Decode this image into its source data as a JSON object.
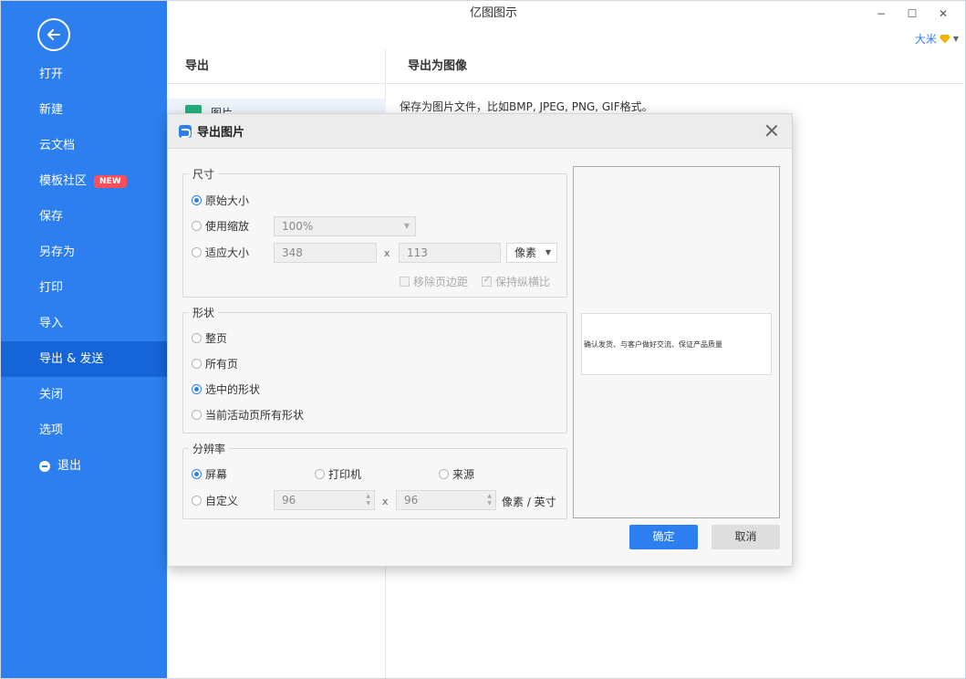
{
  "window": {
    "title": "亿图图示",
    "user_name": "大米",
    "controls": {
      "minimize": "−",
      "maximize": "☐",
      "close": "✕"
    }
  },
  "sidebar": {
    "back_icon": "arrow-left-icon",
    "items": [
      {
        "label": "打开"
      },
      {
        "label": "新建"
      },
      {
        "label": "云文档"
      },
      {
        "label": "模板社区",
        "badge": "NEW"
      },
      {
        "label": "保存"
      },
      {
        "label": "另存为"
      },
      {
        "label": "打印"
      },
      {
        "label": "导入"
      },
      {
        "label": "导出 & 发送",
        "active": true
      },
      {
        "label": "关闭"
      },
      {
        "label": "选项"
      },
      {
        "label": "退出",
        "icon": "minus-circle-icon"
      }
    ]
  },
  "left_panel": {
    "title": "导出",
    "item_label": "图片"
  },
  "right_panel": {
    "title": "导出为图像",
    "description": "保存为图片文件，比如BMP, JPEG, PNG, GIF格式。"
  },
  "dialog": {
    "title": "导出图片",
    "size": {
      "legend": "尺寸",
      "original": "原始大小",
      "use_zoom": "使用缩放",
      "zoom_value": "100%",
      "fit_size": "适应大小",
      "width": "348",
      "height": "113",
      "x": "x",
      "unit": "像素",
      "remove_margin": "移除页边距",
      "keep_ratio": "保持纵横比"
    },
    "shape": {
      "legend": "形状",
      "whole_page": "整页",
      "all_pages": "所有页",
      "selected_shapes": "选中的形状",
      "current_page_shapes": "当前活动页所有形状"
    },
    "resolution": {
      "legend": "分辨率",
      "screen": "屏幕",
      "printer": "打印机",
      "source": "来源",
      "custom": "自定义",
      "dpi_x": "96",
      "dpi_y": "96",
      "x": "x",
      "unit": "像素 / 英寸"
    },
    "preview_text": "确认发货、与客户做好交流、保证产品质量",
    "ok": "确定",
    "cancel": "取消"
  }
}
